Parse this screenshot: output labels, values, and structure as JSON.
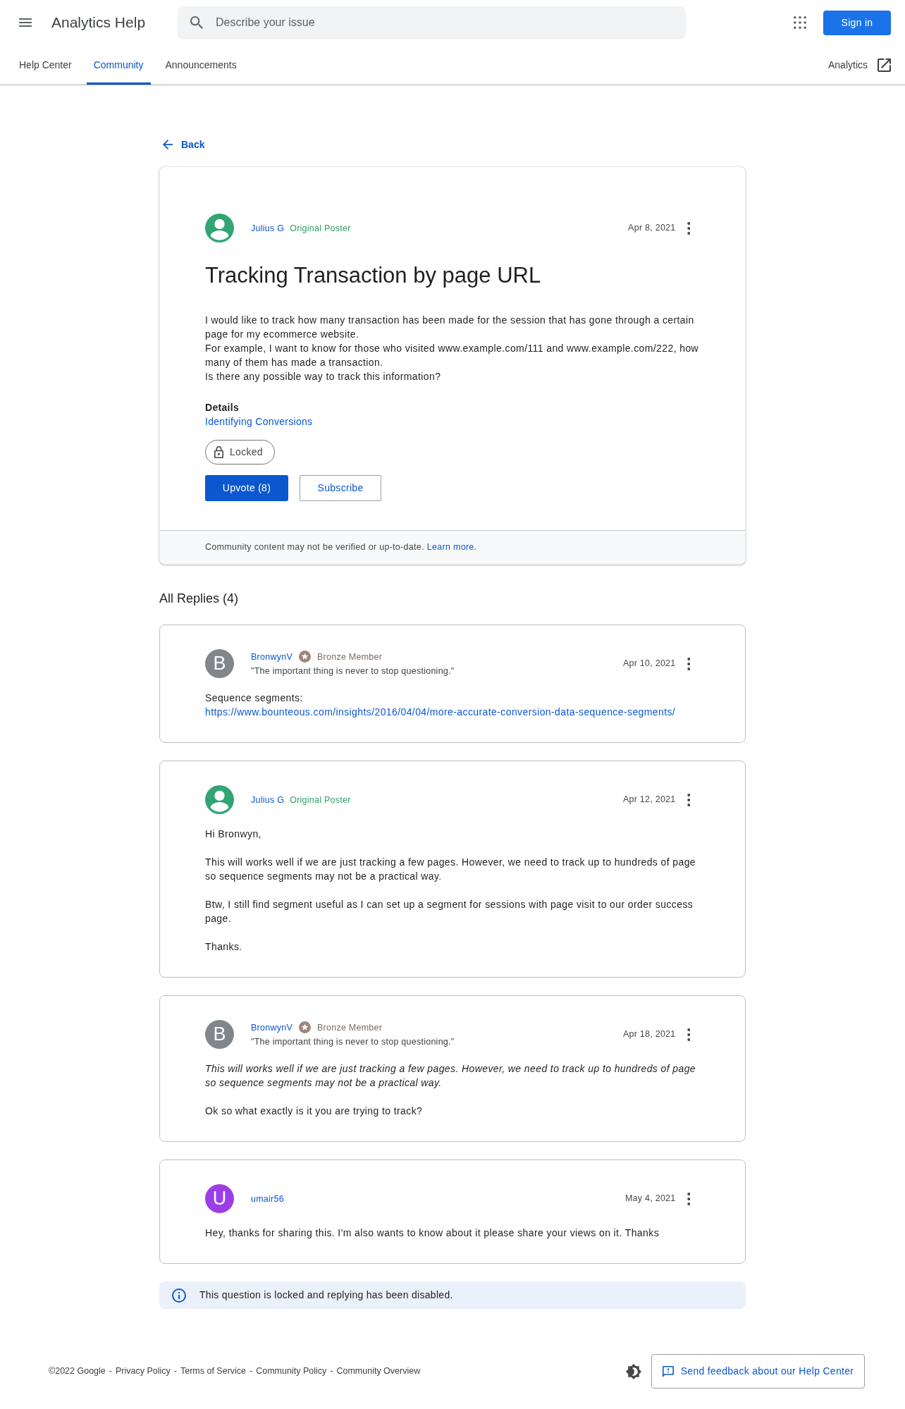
{
  "header": {
    "title": "Analytics Help",
    "search": {
      "placeholder": "Describe your issue"
    },
    "sign_in": "Sign in"
  },
  "tabs": [
    {
      "label": "Help Center",
      "selected": false
    },
    {
      "label": "Community",
      "selected": true
    },
    {
      "label": "Announcements",
      "selected": false
    }
  ],
  "product_link": "Analytics",
  "back": "Back",
  "question": {
    "author": {
      "name": "Julius G",
      "avatar": {
        "kind": "silhouette",
        "color": "#33a474"
      },
      "badge": {
        "kind": "original_poster",
        "label": "Original Poster"
      }
    },
    "date": "Apr 8, 2021",
    "title": "Tracking Transaction by page URL",
    "body": [
      "I would like to track how many transaction has been made for the session that has gone through a certain page for my ecommerce website.",
      "For example, I want to know for those who visited www.example.com/111 and www.example.com/222, how many of them has made a transaction.",
      "Is there any possible way to track this information?"
    ],
    "details": {
      "label": "Details",
      "link": "Identifying Conversions"
    },
    "status": "Locked",
    "upvote": "Upvote (8)",
    "subscribe": "Subscribe",
    "disclaimer": {
      "text": "Community content may not be verified or up-to-date.",
      "link": "Learn more",
      "after": "."
    }
  },
  "replies_heading": "All Replies (4)",
  "replies": [
    {
      "author": {
        "name": "BronwynV",
        "avatar": {
          "kind": "letter",
          "letter": "B",
          "color": "#80868b"
        },
        "badge": {
          "kind": "bronze",
          "label": "Bronze Member"
        },
        "signature": "\"The important thing is never to stop questioning.\""
      },
      "date": "Apr 10, 2021",
      "body": [
        {
          "kind": "text",
          "text": "Sequence segments:"
        },
        {
          "kind": "link",
          "text": "https://www.bounteous.com/insights/2016/04/04/more-accurate-conversion-data-sequence-segments/"
        }
      ]
    },
    {
      "author": {
        "name": "Julius G",
        "avatar": {
          "kind": "silhouette",
          "color": "#33a474"
        },
        "badge": {
          "kind": "original_poster",
          "label": "Original Poster"
        }
      },
      "date": "Apr 12, 2021",
      "body": [
        {
          "kind": "text",
          "text": "Hi Bronwyn,"
        },
        {
          "kind": "text",
          "text": "This will works well if we are just tracking a few pages. However, we need to track up to hundreds of page so sequence segments may not be a practical way."
        },
        {
          "kind": "text",
          "text": "Btw, I still find segment useful as I can set up a segment for sessions with page visit to our order success page."
        },
        {
          "kind": "text",
          "text": "Thanks."
        }
      ]
    },
    {
      "author": {
        "name": "BronwynV",
        "avatar": {
          "kind": "letter",
          "letter": "B",
          "color": "#80868b"
        },
        "badge": {
          "kind": "bronze",
          "label": "Bronze Member"
        },
        "signature": "\"The important thing is never to stop questioning.\""
      },
      "date": "Apr 18, 2021",
      "body": [
        {
          "kind": "quote",
          "text": "This will works well if we are just tracking a few pages. However, we need to track up to hundreds of page so sequence segments may not be a practical way."
        },
        {
          "kind": "text",
          "text": "Ok so what exactly is it you are trying to track?"
        }
      ]
    },
    {
      "author": {
        "name": "umair56",
        "avatar": {
          "kind": "letter",
          "letter": "U",
          "color": "#9c3ee8"
        }
      },
      "date": "May 4, 2021",
      "body": [
        {
          "kind": "text",
          "text": "Hey, thanks for sharing this. I'm also wants to know about it please share your views on it. Thanks"
        }
      ]
    }
  ],
  "notice": "This question is locked and replying has been disabled.",
  "footer": {
    "copyright": "©2022 Google",
    "separator": "-",
    "links": [
      "Privacy Policy",
      "Terms of Service",
      "Community Policy",
      "Community Overview"
    ],
    "feedback": "Send feedback about our Help Center"
  }
}
